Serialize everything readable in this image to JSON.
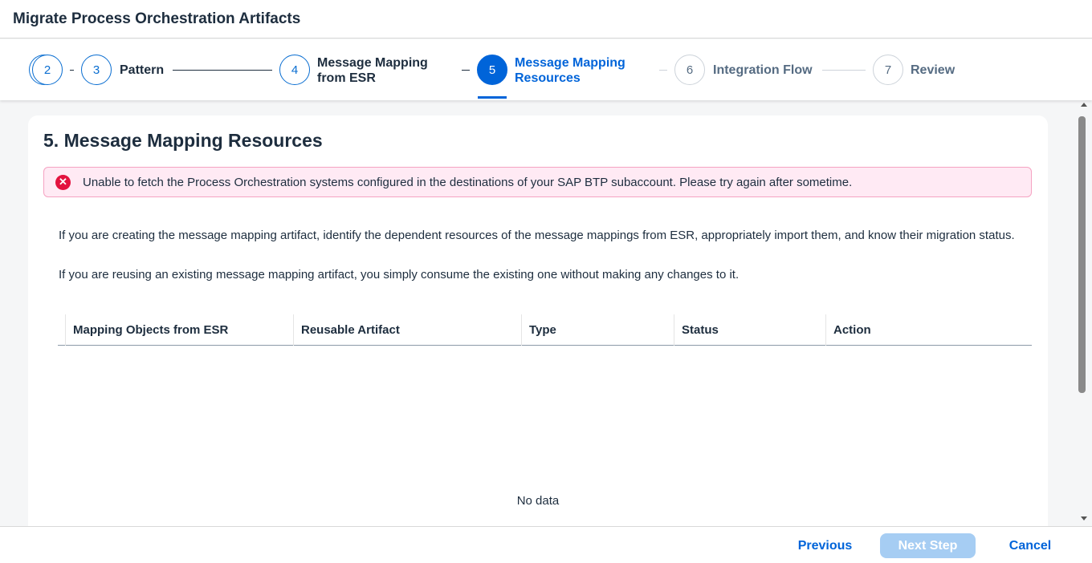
{
  "dialog": {
    "title": "Migrate Process Orchestration Artifacts"
  },
  "wizard": {
    "steps": [
      {
        "number": "2",
        "label": ""
      },
      {
        "number": "3",
        "label": "Pattern"
      },
      {
        "number": "4",
        "label_line1": "Message Mapping",
        "label_line2": "from ESR"
      },
      {
        "number": "5",
        "label_line1": "Message Mapping",
        "label_line2": "Resources"
      },
      {
        "number": "6",
        "label": "Integration Flow"
      },
      {
        "number": "7",
        "label": "Review"
      }
    ]
  },
  "section": {
    "title": "5. Message Mapping Resources",
    "error_message": "Unable to fetch the Process Orchestration systems configured in the destinations of your SAP BTP subaccount. Please try again after sometime.",
    "paragraph1": "If you are creating the message mapping artifact, identify the dependent resources of the message mappings from ESR, appropriately import them, and know their migration status.",
    "paragraph2": "If you are reusing an existing message mapping artifact, you simply consume the existing one without making any changes to it."
  },
  "table": {
    "columns": [
      "Mapping Objects from ESR",
      "Reusable Artifact",
      "Type",
      "Status",
      "Action"
    ],
    "empty_text": "No data"
  },
  "footer": {
    "previous_label": "Previous",
    "next_label": "Next Step",
    "cancel_label": "Cancel"
  },
  "colors": {
    "accent": "#0064d9",
    "error": "#e3123e",
    "next_disabled": "#a6cdf3"
  }
}
